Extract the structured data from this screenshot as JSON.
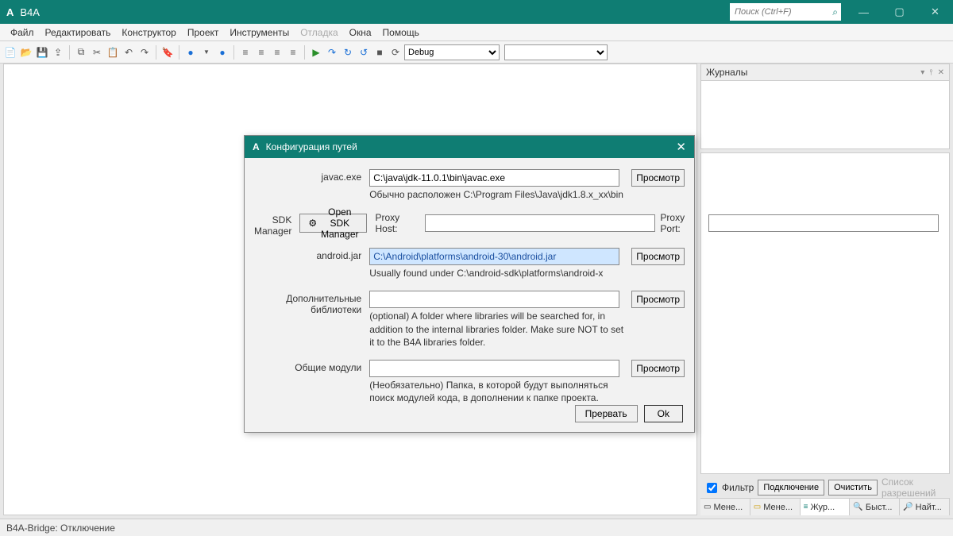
{
  "title": {
    "app": "A",
    "name": "B4A"
  },
  "search": {
    "placeholder": "Поиск (Ctrl+F)"
  },
  "menu": {
    "file": "Файл",
    "edit": "Редактировать",
    "designer": "Конструктор",
    "project": "Проект",
    "tools": "Инструменты",
    "debug": "Отладка",
    "windows": "Окна",
    "help": "Помощь"
  },
  "toolbar": {
    "mode": "Debug"
  },
  "journals": {
    "title": "Журналы",
    "filter": "Фильтр",
    "connect": "Подключение",
    "clear": "Очистить",
    "permissions": "Список разрешений",
    "tabs": {
      "t1": "Мене...",
      "t2": "Мене...",
      "t3": "Жур...",
      "t4": "Быст...",
      "t5": "Найт..."
    }
  },
  "status": "B4A-Bridge: Отключение",
  "dialog": {
    "title": "Конфигурация путей",
    "javac_label": "javac.exe",
    "javac_value": "C:\\java\\jdk-11.0.1\\bin\\javac.exe",
    "javac_hint": "Обычно расположен C:\\Program Files\\Java\\jdk1.8.x_xx\\bin",
    "sdk_label": "SDK Manager",
    "sdk_button": "Open SDK Manager",
    "proxy_host": "Proxy Host:",
    "proxy_port": "Proxy Port:",
    "android_label": "android.jar",
    "android_value": "C:\\Android\\platforms\\android-30\\android.jar",
    "android_hint": "Usually found under C:\\android-sdk\\platforms\\android-x",
    "libs_label": "Дополнительные библиотеки",
    "libs_hint": "(optional) A folder where libraries will be searched for, in addition to the internal libraries folder. Make sure NOT to set it to the B4A libraries folder.",
    "shared_label": "Общие модули",
    "shared_hint": "(Необязательно) Папка, в которой будут выполняться поиск модулей кода, в дополнении к папке проекта.",
    "browse": "Просмотр",
    "cancel": "Прервать",
    "ok": "Ok"
  }
}
